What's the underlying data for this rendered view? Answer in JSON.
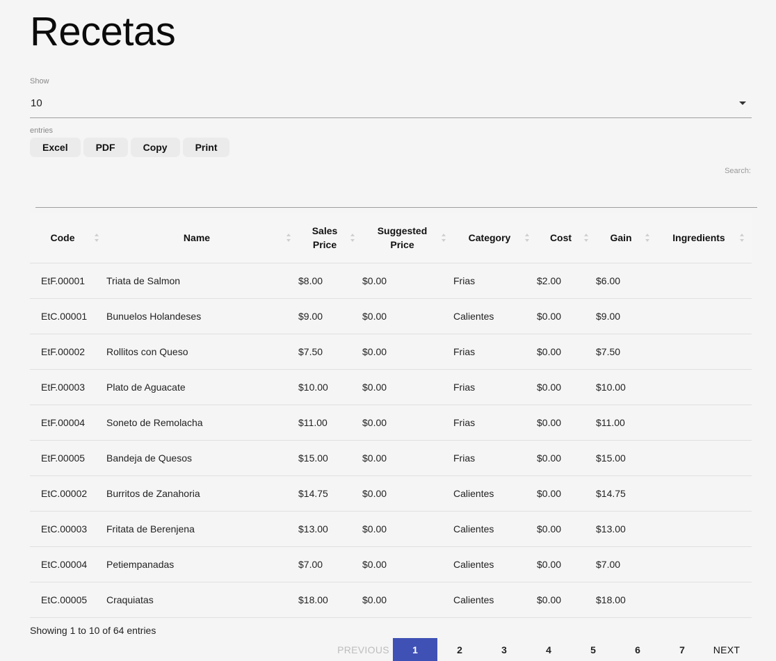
{
  "page": {
    "title": "Recetas"
  },
  "length_menu": {
    "label_before": "Show",
    "value": "10",
    "label_after": "entries"
  },
  "buttons": {
    "excel": "Excel",
    "pdf": "PDF",
    "copy": "Copy",
    "print": "Print"
  },
  "search": {
    "label": "Search:",
    "value": ""
  },
  "table": {
    "headers": [
      "Code",
      "Name",
      "Sales Price",
      "Suggested Price",
      "Category",
      "Cost",
      "Gain",
      "Ingredients"
    ],
    "rows": [
      [
        "EtF.00001",
        "Triata de Salmon",
        "$8.00",
        "$0.00",
        "Frias",
        "$2.00",
        "$6.00",
        ""
      ],
      [
        "EtC.00001",
        "Bunuelos Holandeses",
        "$9.00",
        "$0.00",
        "Calientes",
        "$0.00",
        "$9.00",
        ""
      ],
      [
        "EtF.00002",
        "Rollitos con Queso",
        "$7.50",
        "$0.00",
        "Frias",
        "$0.00",
        "$7.50",
        ""
      ],
      [
        "EtF.00003",
        "Plato de Aguacate",
        "$10.00",
        "$0.00",
        "Frias",
        "$0.00",
        "$10.00",
        ""
      ],
      [
        "EtF.00004",
        "Soneto de Remolacha",
        "$11.00",
        "$0.00",
        "Frias",
        "$0.00",
        "$11.00",
        ""
      ],
      [
        "EtF.00005",
        "Bandeja de Quesos",
        "$15.00",
        "$0.00",
        "Frias",
        "$0.00",
        "$15.00",
        ""
      ],
      [
        "EtC.00002",
        "Burritos de Zanahoria",
        "$14.75",
        "$0.00",
        "Calientes",
        "$0.00",
        "$14.75",
        ""
      ],
      [
        "EtC.00003",
        "Fritata de Berenjena",
        "$13.00",
        "$0.00",
        "Calientes",
        "$0.00",
        "$13.00",
        ""
      ],
      [
        "EtC.00004",
        "Petiempanadas",
        "$7.00",
        "$0.00",
        "Calientes",
        "$0.00",
        "$7.00",
        ""
      ],
      [
        "EtC.00005",
        "Craquiatas",
        "$18.00",
        "$0.00",
        "Calientes",
        "$0.00",
        "$18.00",
        ""
      ]
    ]
  },
  "info": "Showing 1 to 10 of 64 entries",
  "pagination": {
    "previous": "PREVIOUS",
    "pages": [
      "1",
      "2",
      "3",
      "4",
      "5",
      "6",
      "7"
    ],
    "current": "1",
    "next": "NEXT"
  },
  "colors": {
    "accent": "#3f51b5"
  }
}
